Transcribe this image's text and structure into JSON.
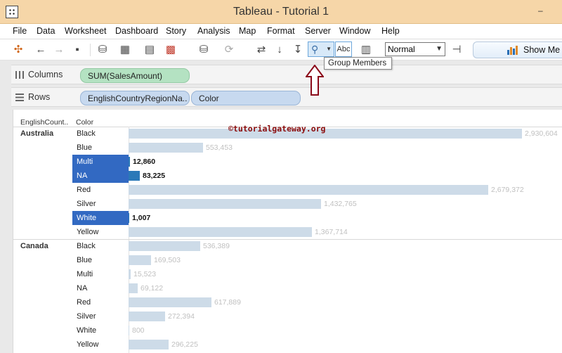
{
  "window": {
    "title": "Tableau - Tutorial 1"
  },
  "menu": [
    "File",
    "Data",
    "Worksheet",
    "Dashboard",
    "Story",
    "Analysis",
    "Map",
    "Format",
    "Server",
    "Window",
    "Help"
  ],
  "toolbar": {
    "fit_value": "Normal",
    "show_me_label": "Show Me",
    "abc_label": "Abc",
    "tooltip": "Group Members"
  },
  "shelves": {
    "columns_label": "Columns",
    "rows_label": "Rows",
    "columns_pill": "SUM(SalesAmount)",
    "rows_pills": [
      "EnglishCountryRegionNa..",
      "Color"
    ]
  },
  "headers": {
    "country": "EnglishCount..",
    "color": "Color"
  },
  "watermark": "©tutorialgateway.org",
  "colors": {
    "bar": "#cddbe8",
    "selected_bar": "#2b79b8",
    "selected_cell": "#3269c2",
    "title_bar": "#f6d6a8"
  },
  "chart_data": {
    "type": "bar",
    "orientation": "horizontal",
    "measure": "SUM(SalesAmount)",
    "groups": [
      {
        "country": "Australia",
        "rows": [
          {
            "color": "Black",
            "value": 2930604,
            "label": "2,930,604",
            "selected": false
          },
          {
            "color": "Blue",
            "value": 553453,
            "label": "553,453",
            "selected": false
          },
          {
            "color": "Multi",
            "value": 12860,
            "label": "12,860",
            "selected": true
          },
          {
            "color": "NA",
            "value": 83225,
            "label": "83,225",
            "selected": true
          },
          {
            "color": "Red",
            "value": 2679372,
            "label": "2,679,372",
            "selected": false
          },
          {
            "color": "Silver",
            "value": 1432765,
            "label": "1,432,765",
            "selected": false
          },
          {
            "color": "White",
            "value": 1007,
            "label": "1,007",
            "selected": true
          },
          {
            "color": "Yellow",
            "value": 1367714,
            "label": "1,367,714",
            "selected": false
          }
        ]
      },
      {
        "country": "Canada",
        "rows": [
          {
            "color": "Black",
            "value": 536389,
            "label": "536,389",
            "selected": false
          },
          {
            "color": "Blue",
            "value": 169503,
            "label": "169,503",
            "selected": false
          },
          {
            "color": "Multi",
            "value": 15523,
            "label": "15,523",
            "selected": false
          },
          {
            "color": "NA",
            "value": 69122,
            "label": "69,122",
            "selected": false
          },
          {
            "color": "Red",
            "value": 617889,
            "label": "617,889",
            "selected": false
          },
          {
            "color": "Silver",
            "value": 272394,
            "label": "272,394",
            "selected": false
          },
          {
            "color": "White",
            "value": 800,
            "label": "800",
            "selected": false
          },
          {
            "color": "Yellow",
            "value": 296225,
            "label": "296,225",
            "selected": false
          }
        ]
      }
    ]
  }
}
